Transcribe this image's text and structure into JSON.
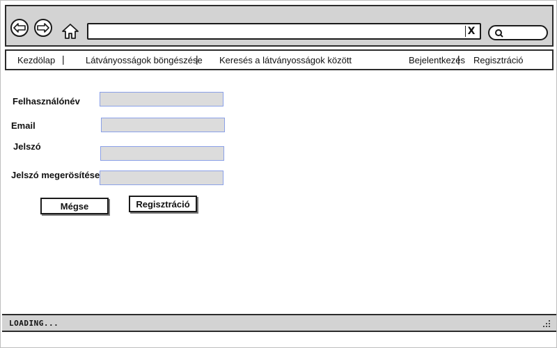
{
  "browser": {
    "url_value": "",
    "clear_glyph": "X",
    "search_value": ""
  },
  "nav": {
    "items": [
      {
        "label": "Kezdölap"
      },
      {
        "label": "Látványosságok böngészése"
      },
      {
        "label": "Keresés a látványosságok között"
      },
      {
        "label": "Bejelentkezés"
      },
      {
        "label": "Regisztráció"
      }
    ],
    "separator": "|"
  },
  "form": {
    "username_label": "Felhasználónév",
    "email_label": "Email",
    "password_label": "Jelszó",
    "confirm_label": "Jelszó megerösítése",
    "username_value": "",
    "email_value": "",
    "password_value": "",
    "confirm_value": "",
    "cancel_label": "Mégse",
    "submit_label": "Regisztráció"
  },
  "status": {
    "text": "LOADING..."
  },
  "icons": {
    "back": "back-arrow-icon",
    "forward": "forward-arrow-icon",
    "home": "home-icon",
    "search": "search-icon",
    "resize": "resize-grip-icon"
  }
}
